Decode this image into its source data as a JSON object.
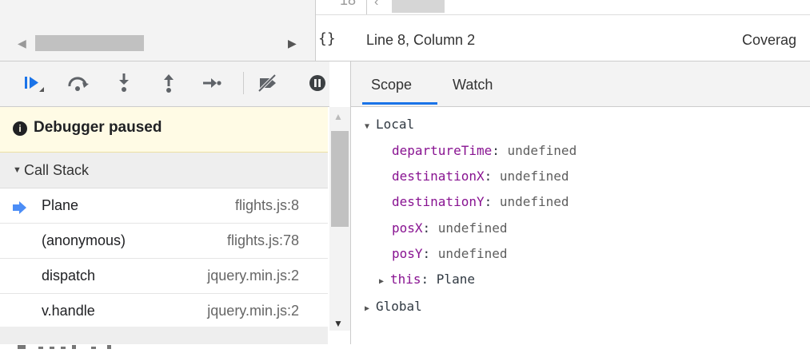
{
  "editor": {
    "line_number_stub": "18",
    "cursor_position": "Line 8, Column 2",
    "coverage_label": "Coverag",
    "braces_glyph": "{}"
  },
  "toolbar": {
    "icons": [
      "resume-icon",
      "step-over-icon",
      "step-into-icon",
      "step-out-icon",
      "step-icon",
      "deactivate-breakpoints-icon",
      "pause-on-exceptions-icon"
    ]
  },
  "paused_banner": {
    "icon_glyph": "i",
    "text": "Debugger paused"
  },
  "call_stack": {
    "title": "Call Stack",
    "frames": [
      {
        "name": "Plane",
        "location": "flights.js:8",
        "current": true
      },
      {
        "name": "(anonymous)",
        "location": "flights.js:78",
        "current": false
      },
      {
        "name": "dispatch",
        "location": "jquery.min.js:2",
        "current": false
      },
      {
        "name": "v.handle",
        "location": "jquery.min.js:2",
        "current": false
      }
    ]
  },
  "breakpoints": {
    "title_partial": "Breakpoints"
  },
  "tabs": {
    "scope": "Scope",
    "watch": "Watch",
    "active": "Scope"
  },
  "scope": {
    "local_label": "Local",
    "variables": [
      {
        "key": "departureTime",
        "value": "undefined"
      },
      {
        "key": "destinationX",
        "value": "undefined"
      },
      {
        "key": "destinationY",
        "value": "undefined"
      },
      {
        "key": "posX",
        "value": "undefined"
      },
      {
        "key": "posY",
        "value": "undefined"
      }
    ],
    "this_entry": {
      "key": "this",
      "value": "Plane"
    },
    "global_label": "Global"
  },
  "colors": {
    "accent": "#1a73e8",
    "paused_bg": "#fffbe5",
    "property_key": "#881391",
    "pointer": "#4c8df6"
  }
}
